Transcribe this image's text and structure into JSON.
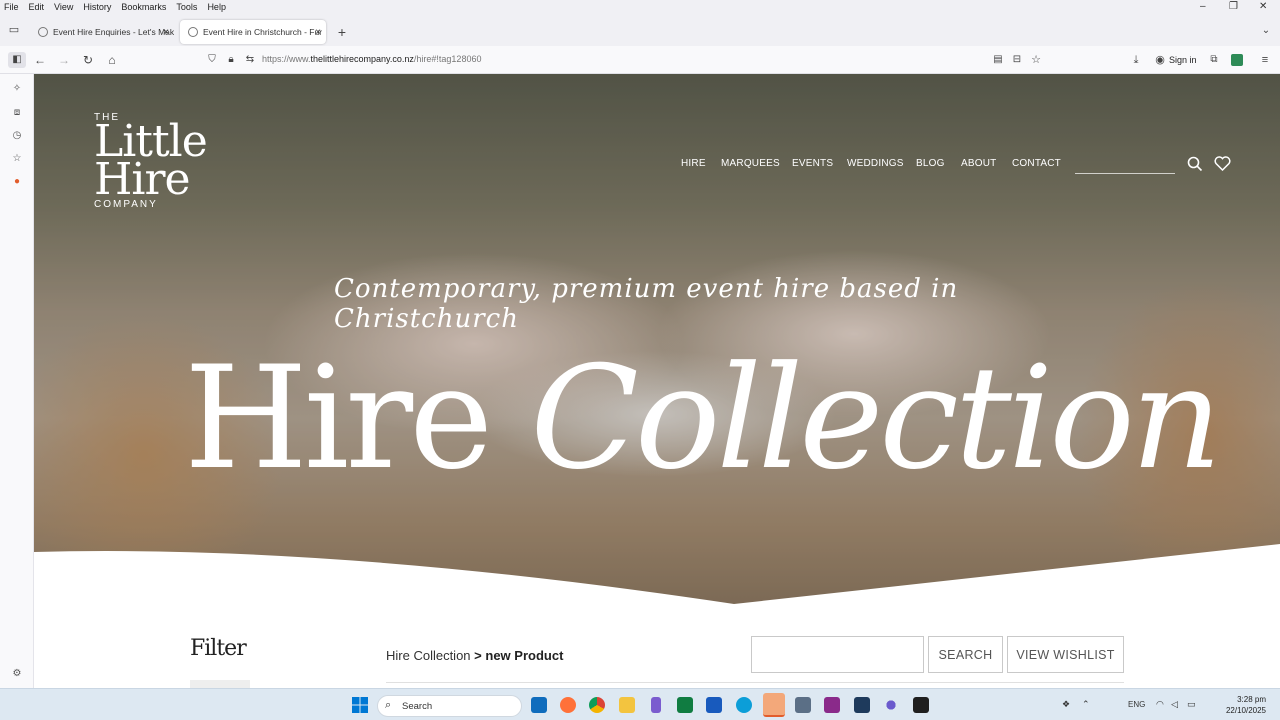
{
  "menubar": {
    "items": [
      "File",
      "Edit",
      "View",
      "History",
      "Bookmarks",
      "Tools",
      "Help"
    ]
  },
  "tabs": [
    {
      "label": "Event Hire Enquiries - Let's Mak",
      "close": "×"
    },
    {
      "label": "Event Hire in Christchurch - Fur",
      "close": "×"
    }
  ],
  "new_tab_label": "+",
  "address": {
    "prefix": "https://www.",
    "domain": "thelittlehirecompany.co.nz",
    "path": "/hire#!tag128060"
  },
  "toolbar": {
    "signin_label": "Sign in"
  },
  "logo": {
    "the": "THE",
    "line1": "Little",
    "line2": "Hire",
    "company": "COMPANY"
  },
  "nav": {
    "items": [
      "HIRE",
      "MARQUEES",
      "EVENTS",
      "WEDDINGS",
      "BLOG",
      "ABOUT",
      "CONTACT"
    ]
  },
  "hero": {
    "tagline": "Contemporary, premium event hire based in Christchurch",
    "headline_1": "Hire ",
    "headline_2": "Collection"
  },
  "filter": {
    "title": "Filter"
  },
  "breadcrumb": {
    "root": "Hire Collection",
    "separator": ">",
    "current": "new Product"
  },
  "product_search": {
    "placeholder": "",
    "search_label": "SEARCH",
    "wishlist_label": "VIEW WISHLIST"
  },
  "taskbar": {
    "search_placeholder": "Search",
    "lang": "ENG",
    "time": "3:28 pm",
    "date": "22/10/2025"
  },
  "colors": {
    "accent": "#e25d2c",
    "hero_text": "#ffffff",
    "taskbar": "#dde8f2"
  }
}
